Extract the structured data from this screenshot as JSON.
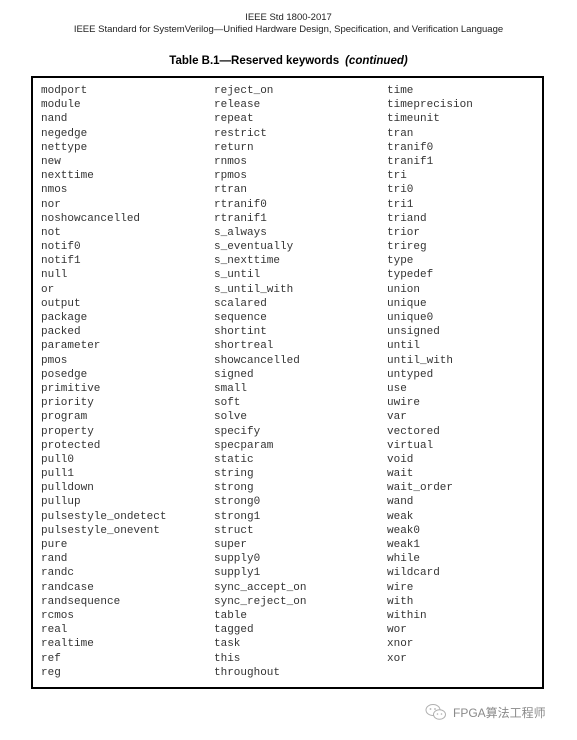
{
  "header": {
    "line1": "IEEE Std 1800-2017",
    "line2": "IEEE Standard for SystemVerilog—Unified Hardware Design, Specification, and Verification Language"
  },
  "table": {
    "title": "Table B.1—Reserved keywords",
    "title_suffix": "(continued)",
    "columns": [
      [
        "modport",
        "module",
        "nand",
        "negedge",
        "nettype",
        "new",
        "nexttime",
        "nmos",
        "nor",
        "noshowcancelled",
        "not",
        "notif0",
        "notif1",
        "null",
        "or",
        "output",
        "package",
        "packed",
        "parameter",
        "pmos",
        "posedge",
        "primitive",
        "priority",
        "program",
        "property",
        "protected",
        "pull0",
        "pull1",
        "pulldown",
        "pullup",
        "pulsestyle_ondetect",
        "pulsestyle_onevent",
        "pure",
        "rand",
        "randc",
        "randcase",
        "randsequence",
        "rcmos",
        "real",
        "realtime",
        "ref",
        "reg"
      ],
      [
        "reject_on",
        "release",
        "repeat",
        "restrict",
        "return",
        "rnmos",
        "rpmos",
        "rtran",
        "rtranif0",
        "rtranif1",
        "s_always",
        "s_eventually",
        "s_nexttime",
        "s_until",
        "s_until_with",
        "scalared",
        "sequence",
        "shortint",
        "shortreal",
        "showcancelled",
        "signed",
        "small",
        "soft",
        "solve",
        "specify",
        "specparam",
        "static",
        "string",
        "strong",
        "strong0",
        "strong1",
        "struct",
        "super",
        "supply0",
        "supply1",
        "sync_accept_on",
        "sync_reject_on",
        "table",
        "tagged",
        "task",
        "this",
        "throughout"
      ],
      [
        "time",
        "timeprecision",
        "timeunit",
        "tran",
        "tranif0",
        "tranif1",
        "tri",
        "tri0",
        "tri1",
        "triand",
        "trior",
        "trireg",
        "type",
        "typedef",
        "union",
        "unique",
        "unique0",
        "unsigned",
        "until",
        "until_with",
        "untyped",
        "use",
        "uwire",
        "var",
        "vectored",
        "virtual",
        "void",
        "wait",
        "wait_order",
        "wand",
        "weak",
        "weak0",
        "weak1",
        "while",
        "wildcard",
        "wire",
        "with",
        "within",
        "wor",
        "xnor",
        "xor"
      ]
    ]
  },
  "watermark": {
    "icon": "wechat-icon",
    "text": "FPGA算法工程师"
  }
}
